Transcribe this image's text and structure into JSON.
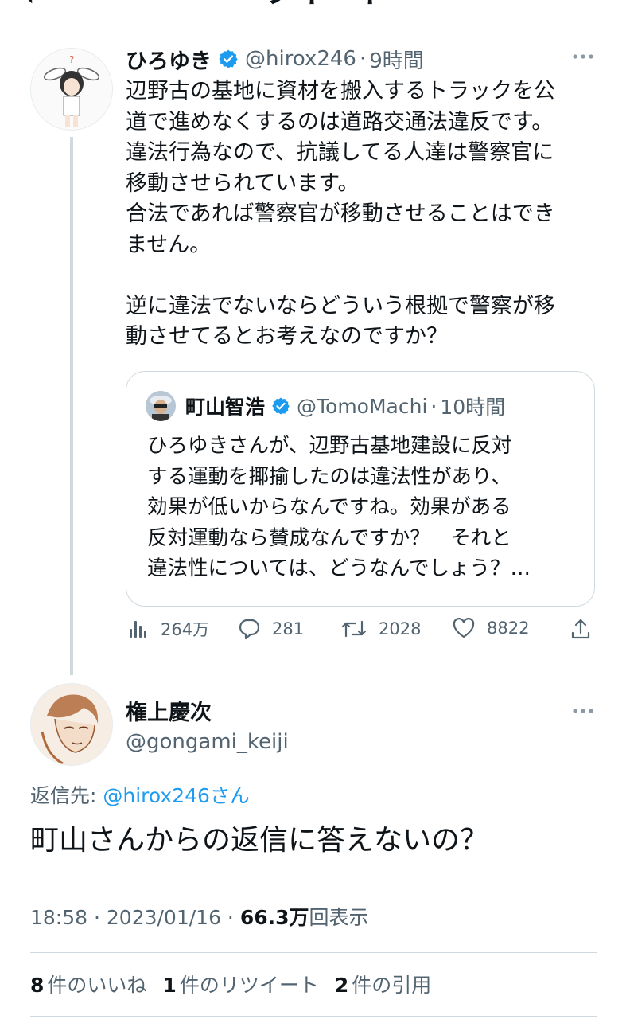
{
  "header": {
    "title": "ツイート",
    "back_glyph": "‹"
  },
  "original_tweet": {
    "author_name": "ひろゆき",
    "handle": "@hirox246",
    "sep": "·",
    "time": "9時間",
    "text": "辺野古の基地に資材を搬入するトラックを公\n道で進めなくするのは道路交通法違反です。\n違法行為なので、抗議してる人達は警察官に\n移動させられています。\n合法であれば警察官が移動させることはでき\nません。\n\n逆に違法でないならどういう根拠で警察が移\n動させてるとお考えなのですか？",
    "quote": {
      "author_name": "町山智浩",
      "handle": "@TomoMachi",
      "sep": "·",
      "time": "10時間",
      "text": "ひろゆきさんが、辺野古基地建設に反対\nする運動を揶揄したのは違法性があり、\n効果が低いからなんですね。効果がある\n反対運動なら賛成なんですか？　それと\n違法性については、どうなんでしょう？…"
    },
    "actions": {
      "views": "264万",
      "replies": "281",
      "retweets": "2028",
      "likes": "8822"
    }
  },
  "reply_tweet": {
    "author_name": "権上慶次",
    "handle": "@gongami_keiji",
    "reply_to_label": "返信先: ",
    "reply_to_handle": "@hirox246",
    "reply_to_suffix": "さん",
    "text": "町山さんからの返信に答えないの？",
    "time": "18:58",
    "sep": " · ",
    "date": "2023/01/16",
    "sep2": " · ",
    "views_count": "66.3万",
    "views_label": "回表示",
    "stats": [
      {
        "count": "8",
        "label": "件のいいね"
      },
      {
        "count": "1",
        "label": "件のリツイート"
      },
      {
        "count": "2",
        "label": "件の引用"
      }
    ]
  },
  "colors": {
    "accent": "#1d9bf0",
    "text": "#0f1419",
    "muted": "#536471",
    "border": "#cfd9de"
  },
  "icons": [
    "chevron-left-icon",
    "verified-badge-icon",
    "more-icon",
    "views-icon",
    "reply-icon",
    "retweet-icon",
    "like-icon",
    "share-icon"
  ]
}
